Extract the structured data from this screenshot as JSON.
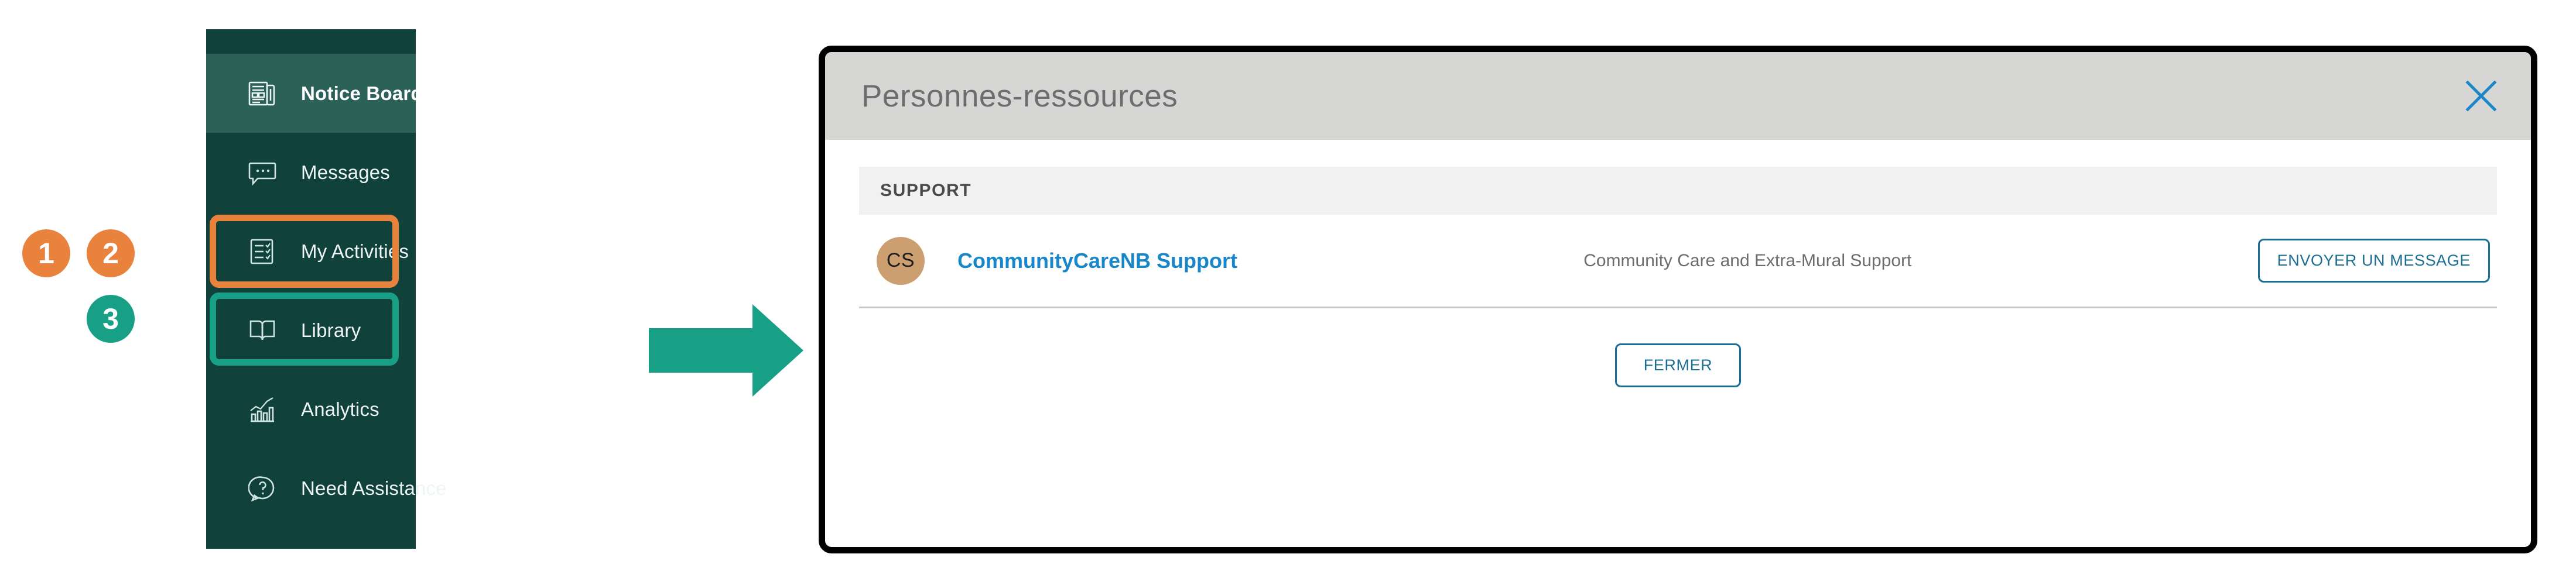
{
  "steps": [
    {
      "id": "step-1",
      "label": "1",
      "color": "#E8823C"
    },
    {
      "id": "step-2",
      "label": "2",
      "color": "#E8823C"
    },
    {
      "id": "step-3",
      "label": "3",
      "color": "#17A085"
    }
  ],
  "sidebar": {
    "background": "#10413A",
    "active_background": "#2C6158",
    "items": [
      {
        "label": "Notice Board",
        "icon": "newspaper-icon",
        "active": true
      },
      {
        "label": "Messages",
        "icon": "chat-bubble-icon",
        "active": false
      },
      {
        "label": "My Activities",
        "icon": "checklist-icon",
        "active": false,
        "highlight": "#E8823C"
      },
      {
        "label": "Library",
        "icon": "open-book-icon",
        "active": false,
        "highlight": "#17A085"
      },
      {
        "label": "Analytics",
        "icon": "bar-chart-icon",
        "active": false
      },
      {
        "label": "Need Assistance",
        "icon": "question-help-icon",
        "active": false
      }
    ]
  },
  "arrow": {
    "icon": "arrow-right-icon",
    "color": "#17A085"
  },
  "modal": {
    "title": "Personnes-ressources",
    "close_icon": "close-x-icon",
    "close_icon_color": "#1B87C9",
    "header_background": "#D6D6D4",
    "section": {
      "title": "SUPPORT",
      "contacts": [
        {
          "initials": "CS",
          "avatar_color": "#CC9F70",
          "name": "CommunityCareNB Support",
          "name_color": "#1886C8",
          "description": "Community Care and Extra-Mural Support",
          "action_label": "ENVOYER UN MESSAGE"
        }
      ]
    },
    "footer": {
      "close_label": "FERMER"
    },
    "accent_color": "#1B6E93"
  }
}
